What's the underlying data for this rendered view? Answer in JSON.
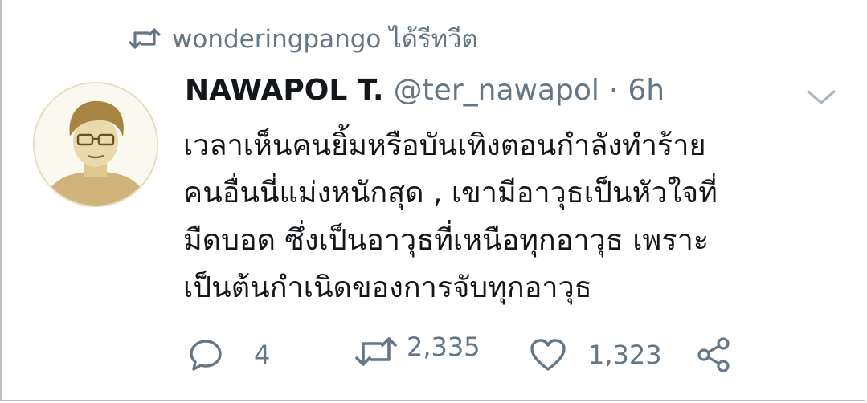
{
  "retweet_banner": {
    "icon": "retweet-icon",
    "text": "wonderingpango ได้รีทวีต"
  },
  "author": {
    "avatar": "avatar",
    "display_name": "NAWAPOL T.",
    "handle": "@ter_nawapol",
    "separator": "·",
    "time": "6h"
  },
  "tweet": {
    "lines": [
      "เวลาเห็นคนยิ้มหรือบันเทิงตอนกำลังทำร้าย",
      "คนอื่นนี่แม่งหนักสุด , เขามีอาวุธเป็นหัวใจที่",
      "มืดบอด ซึ่งเป็นอาวุธที่เหนือทุกอาวุธ เพราะ",
      "เป็นต้นกำเนิดของการจับทุกอาวุธ"
    ]
  },
  "actions": {
    "reply": {
      "icon": "reply-icon",
      "count": "4"
    },
    "retweet": {
      "icon": "retweet-icon",
      "count": "2,335"
    },
    "like": {
      "icon": "heart-icon",
      "count": "1,323"
    },
    "share": {
      "icon": "share-icon"
    }
  },
  "colors": {
    "text_primary": "#14171a",
    "text_secondary": "#657786",
    "avatar_tone": "#c8a766"
  }
}
